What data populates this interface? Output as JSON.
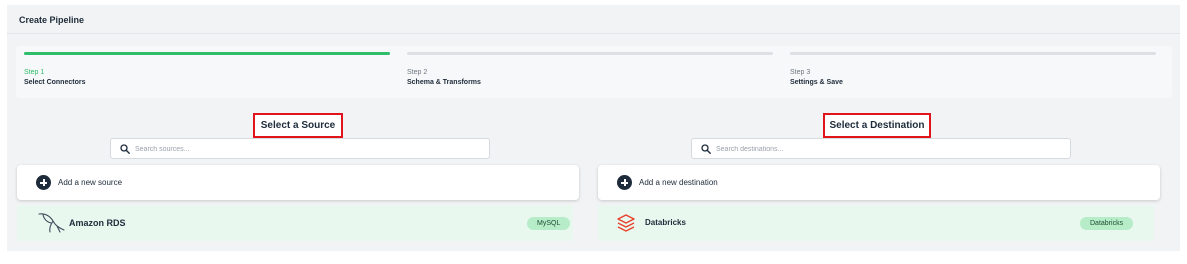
{
  "header": {
    "title": "Create Pipeline"
  },
  "steps": [
    {
      "number": "Step 1",
      "name": "Select Connectors",
      "active": true
    },
    {
      "number": "Step 2",
      "name": "Schema & Transforms",
      "active": false
    },
    {
      "number": "Step 3",
      "name": "Settings & Save",
      "active": false
    }
  ],
  "source": {
    "title": "Select a Source",
    "search_placeholder": "Search sources...",
    "add_label": "Add a new source",
    "connector": {
      "name": "Amazon RDS",
      "badge": "MySQL",
      "icon": "mysql-dolphin-icon"
    }
  },
  "destination": {
    "title": "Select a Destination",
    "search_placeholder": "Search destinations...",
    "add_label": "Add a new destination",
    "connector": {
      "name": "Databricks",
      "badge": "Databricks",
      "icon": "databricks-logo-icon"
    }
  },
  "colors": {
    "accent_green": "#2ebd6b",
    "highlight_red": "#e0151b",
    "card_green": "#e9f8ee",
    "badge_green": "#b6ecc8",
    "dark_text": "#1d2b3a"
  }
}
